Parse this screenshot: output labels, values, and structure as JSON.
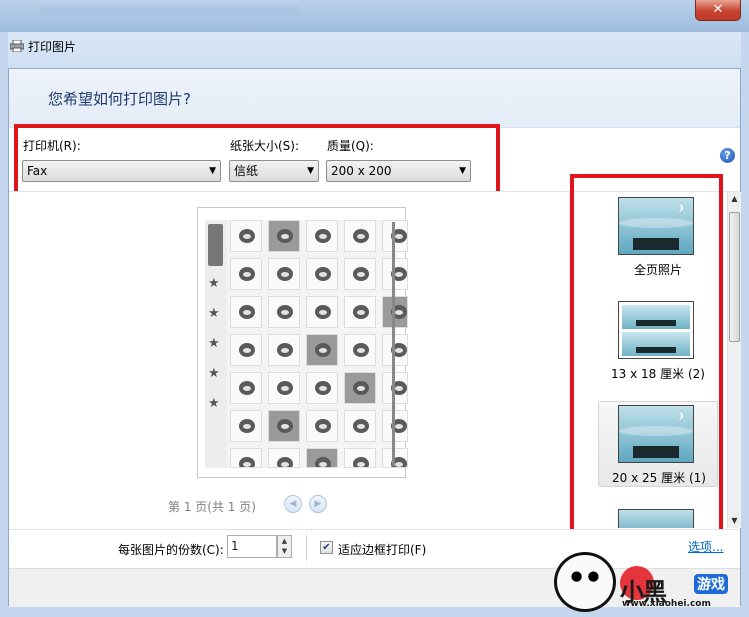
{
  "window": {
    "title": "打印图片",
    "close_label": "✕"
  },
  "main": {
    "question": "您希望如何打印图片?",
    "printer": {
      "label": "打印机(R):",
      "value": "Fax"
    },
    "paper_size": {
      "label": "纸张大小(S):",
      "value": "信纸"
    },
    "quality": {
      "label": "质量(Q):",
      "value": "200 x 200"
    },
    "help_label": "?",
    "pager": {
      "text": "第 1 页(共 1 页)",
      "prev_label": "◀",
      "next_label": "▶"
    }
  },
  "layouts": [
    {
      "label": "全页照片"
    },
    {
      "label": "13 x 18 厘米 (2)"
    },
    {
      "label": "20 x 25 厘米 (1)",
      "selected": true
    }
  ],
  "bottom": {
    "copies_label": "每张图片的份数(C):",
    "copies_value": "1",
    "fit_label": "适应边框打印(F)",
    "fit_checked": true,
    "options_link": "选项..."
  },
  "watermark": {
    "brand": "小黑",
    "game": "游戏",
    "url": "www.xiaohei.com"
  },
  "colors": {
    "highlight_border": "#e0141b",
    "question_text": "#1e3a70",
    "link": "#0066cc"
  }
}
